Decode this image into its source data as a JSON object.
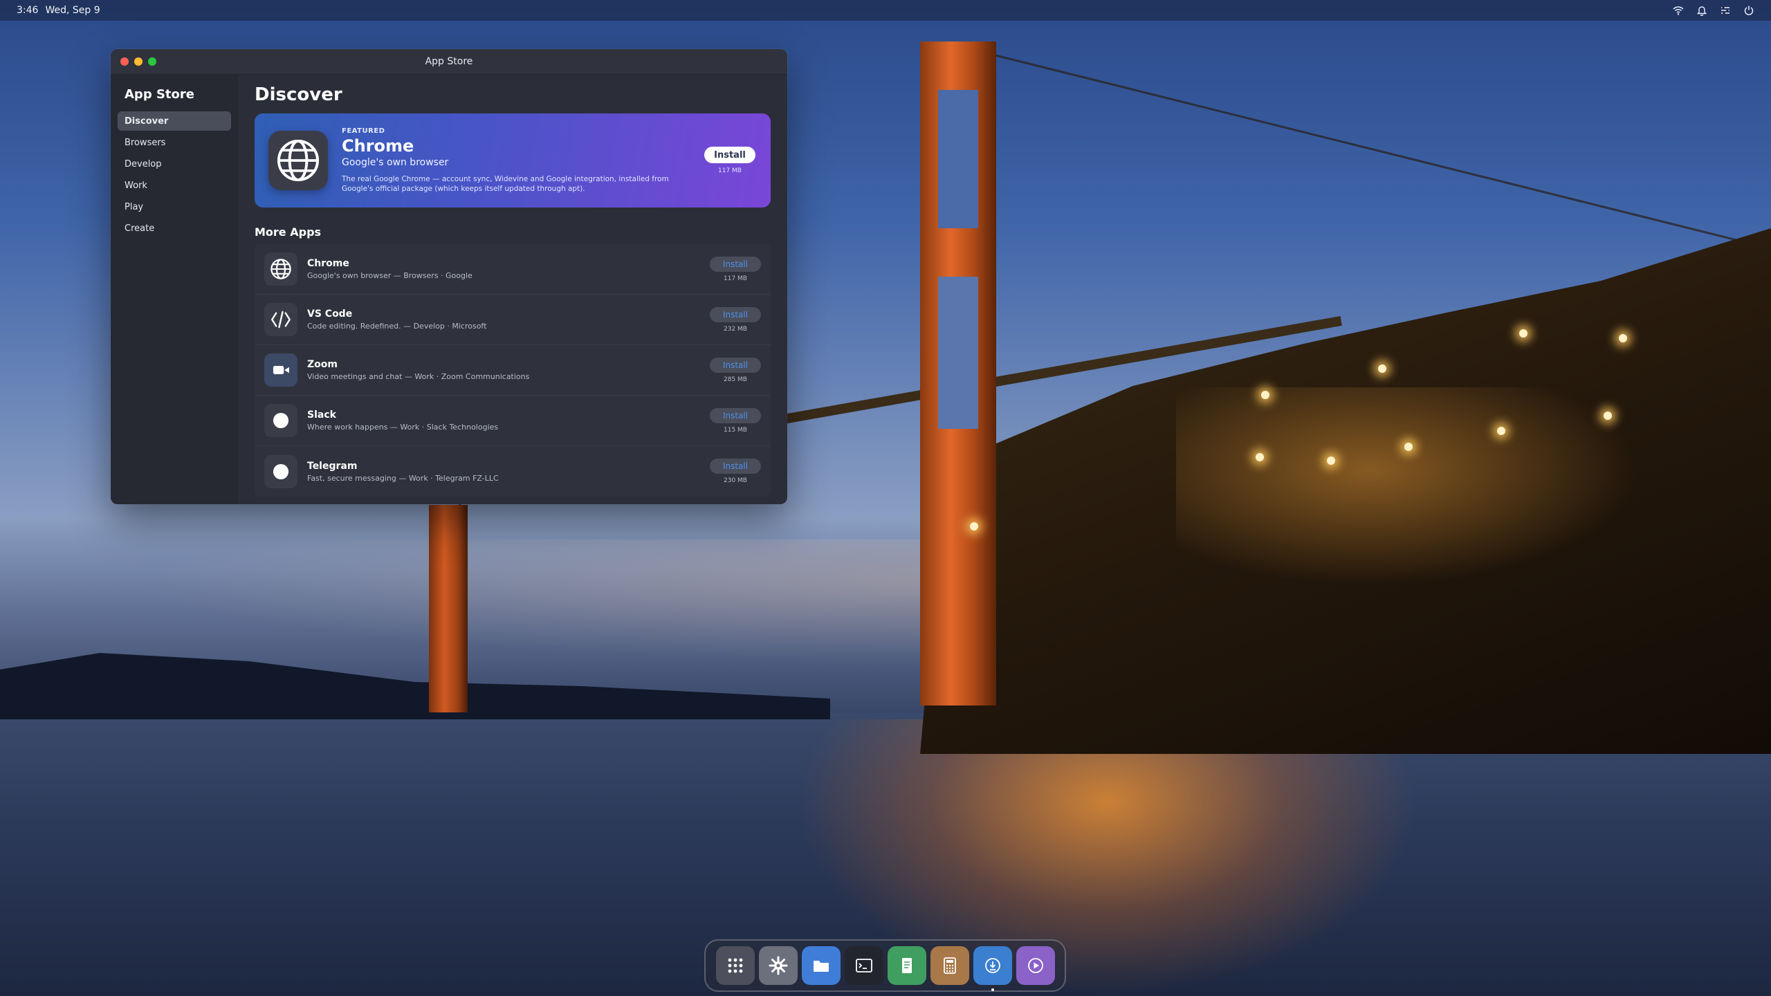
{
  "topbar": {
    "time": "3:46",
    "date": "Wed, Sep 9",
    "tray_icons": [
      "wifi-icon",
      "bell-icon",
      "settings-sliders-icon",
      "power-icon"
    ]
  },
  "window": {
    "title": "App Store",
    "sidebar": {
      "title": "App Store",
      "items": [
        {
          "label": "Discover",
          "active": true
        },
        {
          "label": "Browsers",
          "active": false
        },
        {
          "label": "Develop",
          "active": false
        },
        {
          "label": "Work",
          "active": false
        },
        {
          "label": "Play",
          "active": false
        },
        {
          "label": "Create",
          "active": false
        }
      ]
    },
    "main": {
      "title": "Discover",
      "featured": {
        "kicker": "FEATURED",
        "name": "Chrome",
        "tagline": "Google's own browser",
        "description": "The real Google Chrome — account sync, Widevine and Google integration, installed from Google's official package (which keeps itself updated through apt).",
        "install_label": "Install",
        "size": "117 MB",
        "icon": "globe-icon"
      },
      "more_apps_title": "More Apps",
      "apps": [
        {
          "name": "Chrome",
          "meta": "Google's own browser — Browsers · Google",
          "install_label": "Install",
          "size": "117 MB",
          "icon": "globe-icon"
        },
        {
          "name": "VS Code",
          "meta": "Code editing. Redefined. — Develop · Microsoft",
          "install_label": "Install",
          "size": "232 MB",
          "icon": "code-icon"
        },
        {
          "name": "Zoom",
          "meta": "Video meetings and chat — Work · Zoom Communications",
          "install_label": "Install",
          "size": "285 MB",
          "icon": "video-camera-icon"
        },
        {
          "name": "Slack",
          "meta": "Where work happens — Work · Slack Technologies",
          "install_label": "Install",
          "size": "115 MB",
          "icon": "circle-icon"
        },
        {
          "name": "Telegram",
          "meta": "Fast, secure messaging — Work · Telegram FZ-LLC",
          "install_label": "Install",
          "size": "230 MB",
          "icon": "circle-icon"
        }
      ]
    }
  },
  "dock": {
    "items": [
      {
        "name": "app-grid",
        "icon": "app-grid-icon",
        "running": false
      },
      {
        "name": "settings",
        "icon": "gear-icon",
        "running": false
      },
      {
        "name": "files",
        "icon": "folder-icon",
        "running": false
      },
      {
        "name": "terminal",
        "icon": "terminal-icon",
        "running": false
      },
      {
        "name": "text-editor",
        "icon": "document-icon",
        "running": false
      },
      {
        "name": "calculator",
        "icon": "calculator-icon",
        "running": false
      },
      {
        "name": "app-store",
        "icon": "app-store-icon",
        "running": true
      },
      {
        "name": "media-player",
        "icon": "play-icon",
        "running": false
      }
    ]
  },
  "colors": {
    "window_bg": "#2b2e38",
    "sidebar_bg": "#262932",
    "featured_gradient_start": "#2f5fb4",
    "featured_gradient_end": "#7a46d8",
    "install_text": "#4d8fe8"
  }
}
